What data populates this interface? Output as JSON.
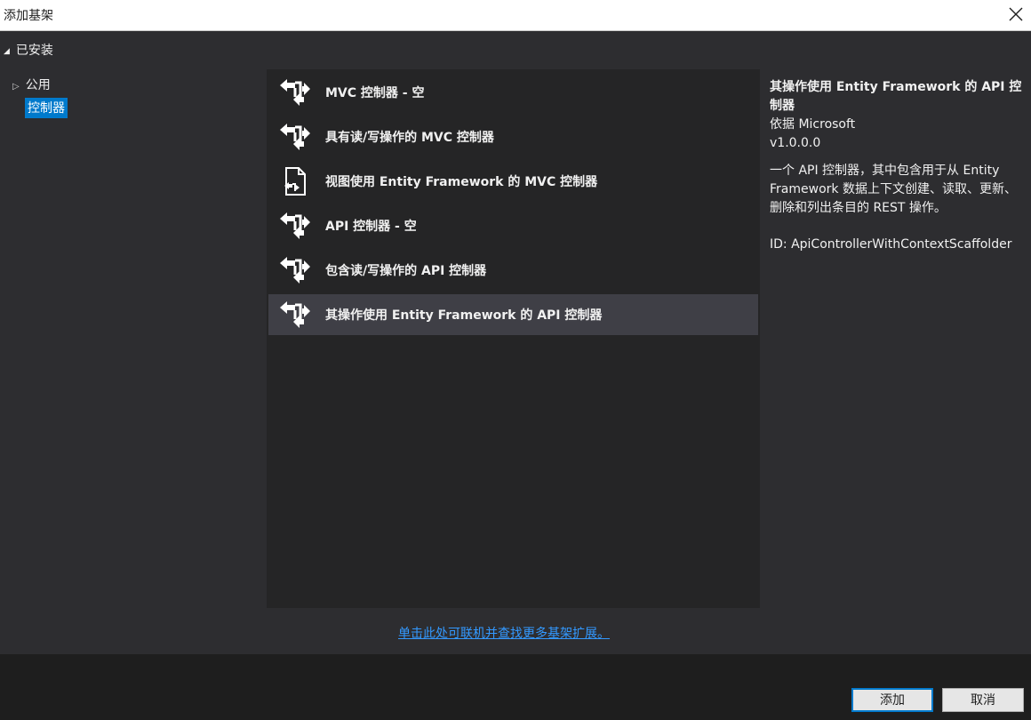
{
  "window": {
    "title": "添加基架",
    "close_icon": "close-icon"
  },
  "tree": {
    "header": "已安装",
    "items": [
      {
        "label": "公用",
        "expanded": false
      },
      {
        "label": "控制器",
        "selected": true
      }
    ]
  },
  "templates": [
    {
      "label": "MVC 控制器 - 空",
      "icon": "controller-icon"
    },
    {
      "label": "具有读/写操作的 MVC 控制器",
      "icon": "controller-icon"
    },
    {
      "label": "视图使用 Entity Framework 的 MVC 控制器",
      "icon": "view-file-icon"
    },
    {
      "label": "API 控制器 - 空",
      "icon": "controller-icon"
    },
    {
      "label": "包含读/写操作的 API 控制器",
      "icon": "controller-icon"
    },
    {
      "label": "其操作使用 Entity Framework 的 API 控制器",
      "icon": "controller-icon",
      "selected": true
    }
  ],
  "details": {
    "title": "其操作使用 Entity Framework 的 API 控制器",
    "author": "依据 Microsoft",
    "version": "v1.0.0.0",
    "description": "一个 API 控制器，其中包含用于从 Entity Framework 数据上下文创建、读取、更新、删除和列出条目的 REST 操作。",
    "id": "ID: ApiControllerWithContextScaffolder"
  },
  "online_link": "单击此处可联机并查找更多基架扩展。",
  "buttons": {
    "add": "添加",
    "cancel": "取消"
  },
  "colors": {
    "accent": "#007acc",
    "selected_row": "#3f3f46",
    "link": "#3399ff"
  }
}
